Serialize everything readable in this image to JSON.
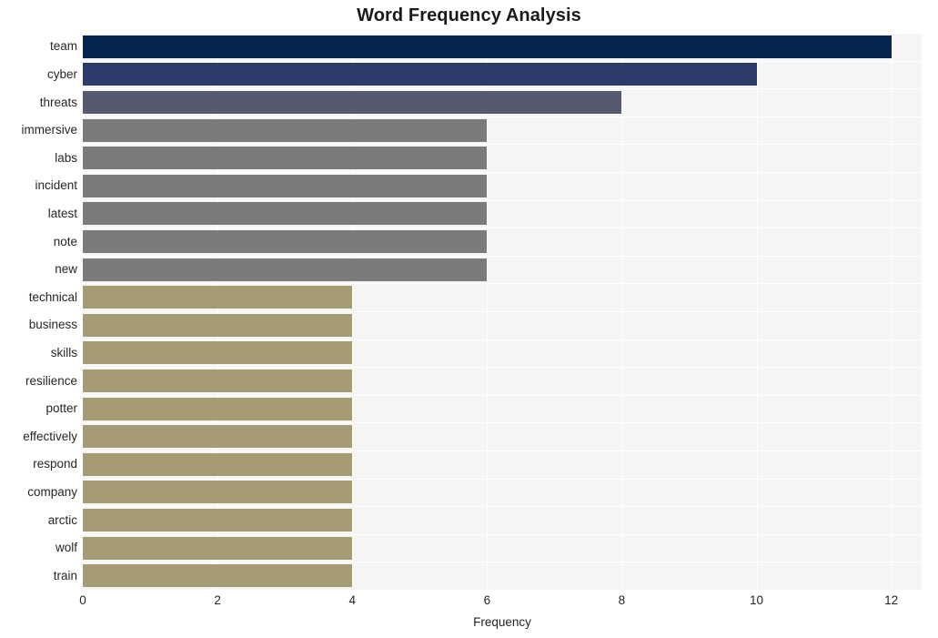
{
  "chart_data": {
    "type": "bar",
    "orientation": "horizontal",
    "title": "Word Frequency Analysis",
    "xlabel": "Frequency",
    "ylabel": "",
    "categories": [
      "team",
      "cyber",
      "threats",
      "immersive",
      "labs",
      "incident",
      "latest",
      "note",
      "new",
      "technical",
      "business",
      "skills",
      "resilience",
      "potter",
      "effectively",
      "respond",
      "company",
      "arctic",
      "wolf",
      "train"
    ],
    "values": [
      12,
      10,
      8,
      6,
      6,
      6,
      6,
      6,
      6,
      4,
      4,
      4,
      4,
      4,
      4,
      4,
      4,
      4,
      4,
      4
    ],
    "bar_colors": [
      "#04254d",
      "#2d3b6b",
      "#565a6e",
      "#7b7b7b",
      "#7b7b7b",
      "#7b7b7b",
      "#7b7b7b",
      "#7b7b7b",
      "#7b7b7b",
      "#a59c74",
      "#a59c74",
      "#a59c74",
      "#a59c74",
      "#a59c74",
      "#a59c74",
      "#a59c74",
      "#a59c74",
      "#a59c74",
      "#a59c74",
      "#a59c74"
    ],
    "xlim": [
      0,
      12.45
    ],
    "xticks": [
      0,
      2,
      4,
      6,
      8,
      10,
      12
    ],
    "xtick_labels": [
      "0",
      "2",
      "4",
      "6",
      "8",
      "10",
      "12"
    ],
    "grid": true,
    "grid_color": "#ffffff",
    "plot_background": "#f5f5f5",
    "figure_background": "#ffffff",
    "legend": null
  },
  "colors": {
    "title_text": "#1a1a1a",
    "tick_text": "#262626",
    "axis_label_text": "#262626"
  }
}
